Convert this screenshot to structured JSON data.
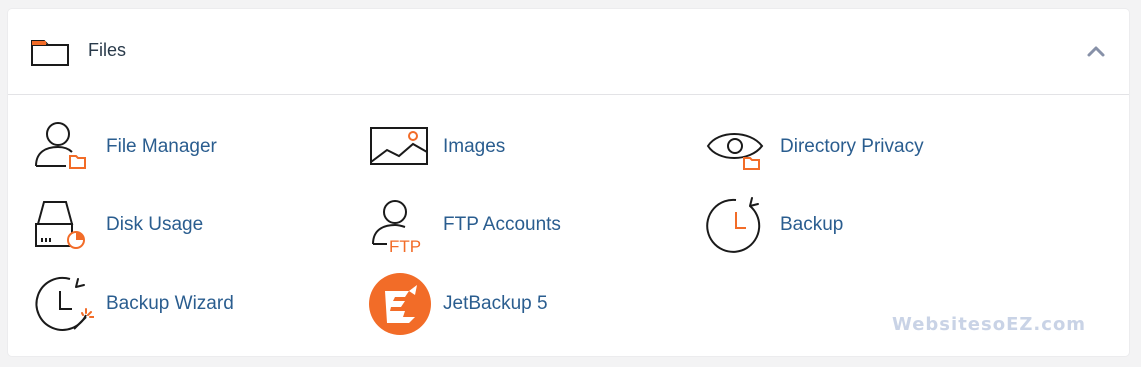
{
  "section": {
    "title": "Files",
    "collapse_icon": "chevron-up-icon"
  },
  "items": [
    {
      "label": "File Manager",
      "icon": "file-manager-icon"
    },
    {
      "label": "Images",
      "icon": "images-icon"
    },
    {
      "label": "Directory Privacy",
      "icon": "directory-privacy-icon"
    },
    {
      "label": "Disk Usage",
      "icon": "disk-usage-icon"
    },
    {
      "label": "FTP Accounts",
      "icon": "ftp-accounts-icon"
    },
    {
      "label": "Backup",
      "icon": "backup-icon"
    },
    {
      "label": "Backup Wizard",
      "icon": "backup-wizard-icon"
    },
    {
      "label": "JetBackup 5",
      "icon": "jetbackup-icon"
    }
  ],
  "ftp_icon_text": "FTP",
  "watermark": "WebsitesoEZ.com",
  "colors": {
    "accent": "#f26c28",
    "link": "#2a5d8f",
    "icon_stroke": "#1a1a1a"
  }
}
